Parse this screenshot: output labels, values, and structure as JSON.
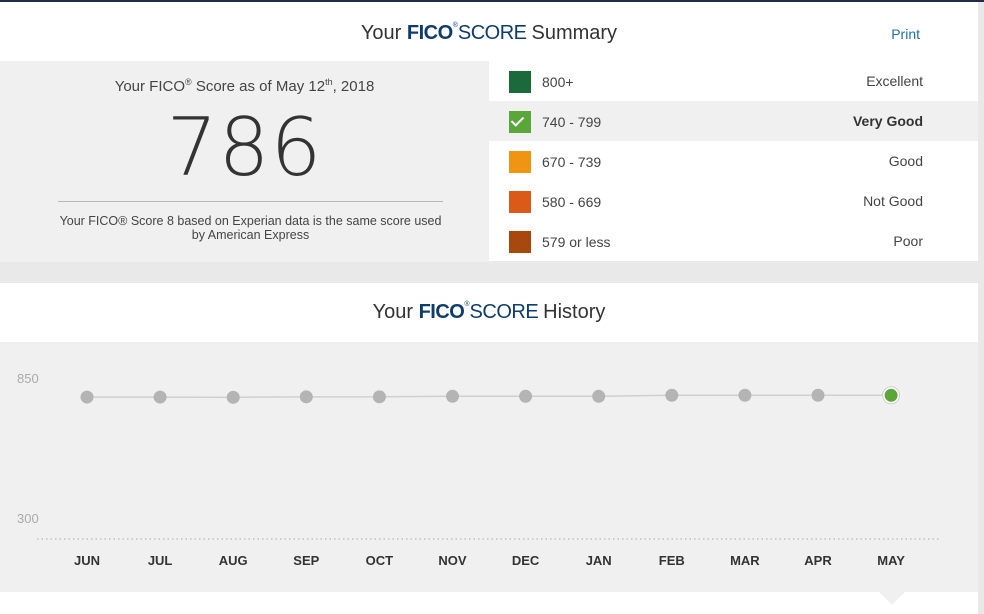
{
  "summary": {
    "title_prefix": "Your",
    "title_fico": "FICO",
    "title_reg": "®",
    "title_score": "SCORE",
    "title_suffix": "Summary",
    "print_label": "Print"
  },
  "score": {
    "asof_prefix": "Your FICO",
    "asof_reg": "®",
    "asof_mid": " Score as of May 12",
    "asof_sup": "th",
    "asof_year": ", 2018",
    "value": "786",
    "note": "Your FICO® Score 8 based on Experian data is the same score used by American Express"
  },
  "ranges": [
    {
      "range": "800+",
      "label": "Excellent",
      "color": "#1b6a3a",
      "active": false
    },
    {
      "range": "740 - 799",
      "label": "Very Good",
      "color": "#5aa63a",
      "active": true
    },
    {
      "range": "670 - 739",
      "label": "Good",
      "color": "#ef9512",
      "active": false
    },
    {
      "range": "580 - 669",
      "label": "Not Good",
      "color": "#dc5a18",
      "active": false
    },
    {
      "range": "579 or less",
      "label": "Poor",
      "color": "#a8480e",
      "active": false
    }
  ],
  "history": {
    "title_prefix": "Your",
    "title_fico": "FICO",
    "title_reg": "®",
    "title_score": "SCORE",
    "title_suffix": "History"
  },
  "chart_data": {
    "type": "line",
    "categories": [
      "JUN",
      "JUL",
      "AUG",
      "SEP",
      "OCT",
      "NOV",
      "DEC",
      "JAN",
      "FEB",
      "MAR",
      "APR",
      "MAY"
    ],
    "values": [
      779,
      779,
      778,
      780,
      780,
      782,
      782,
      782,
      786,
      786,
      786,
      786
    ],
    "ylim": [
      300,
      850
    ],
    "yticks": [
      "850",
      "300"
    ],
    "highlight_index": 11,
    "point_color": "#b4b4b4",
    "line_color": "#d0d0d0",
    "highlight_color": "#5aa63a"
  }
}
